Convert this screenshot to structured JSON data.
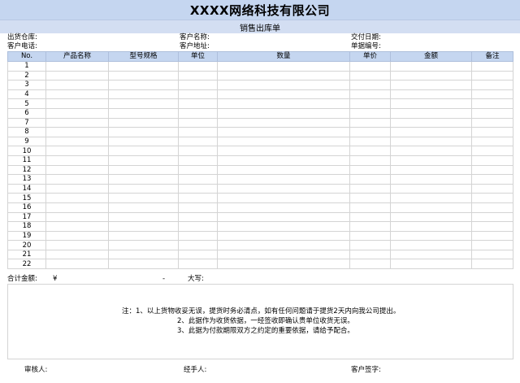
{
  "header": {
    "title": "XXXX网络科技有限公司",
    "subtitle": "销售出库单"
  },
  "info": {
    "warehouse_label": "出货仓库:",
    "customer_name_label": "客户名称:",
    "delivery_date_label": "交付日期:",
    "customer_phone_label": "客户电话:",
    "customer_address_label": "客户地址:",
    "doc_number_label": "单据编号:"
  },
  "table": {
    "columns": [
      "No.",
      "产品名称",
      "型号规格",
      "单位",
      "数量",
      "单价",
      "金额",
      "备注"
    ],
    "rows": [
      "1",
      "2",
      "3",
      "4",
      "5",
      "6",
      "7",
      "8",
      "9",
      "10",
      "11",
      "12",
      "13",
      "14",
      "15",
      "16",
      "17",
      "18",
      "19",
      "20",
      "21",
      "22"
    ]
  },
  "totals": {
    "label": "合计金额:",
    "currency": "¥",
    "amount": "-",
    "capital_label": "大写:"
  },
  "notes": {
    "line1": "注：1、以上货物收妥无误，提货时务必清点，如有任何问题请于提货2天内向我公司提出。",
    "line2": "2、此据作为收货依据，一经签收即确认贵单位收货无误。",
    "line3": "3、此据为付款期限双方之约定的重要依据，请给予配合。"
  },
  "signatures": {
    "reviewer": "审核人:",
    "handler": "经手人:",
    "customer": "客户签字:"
  }
}
